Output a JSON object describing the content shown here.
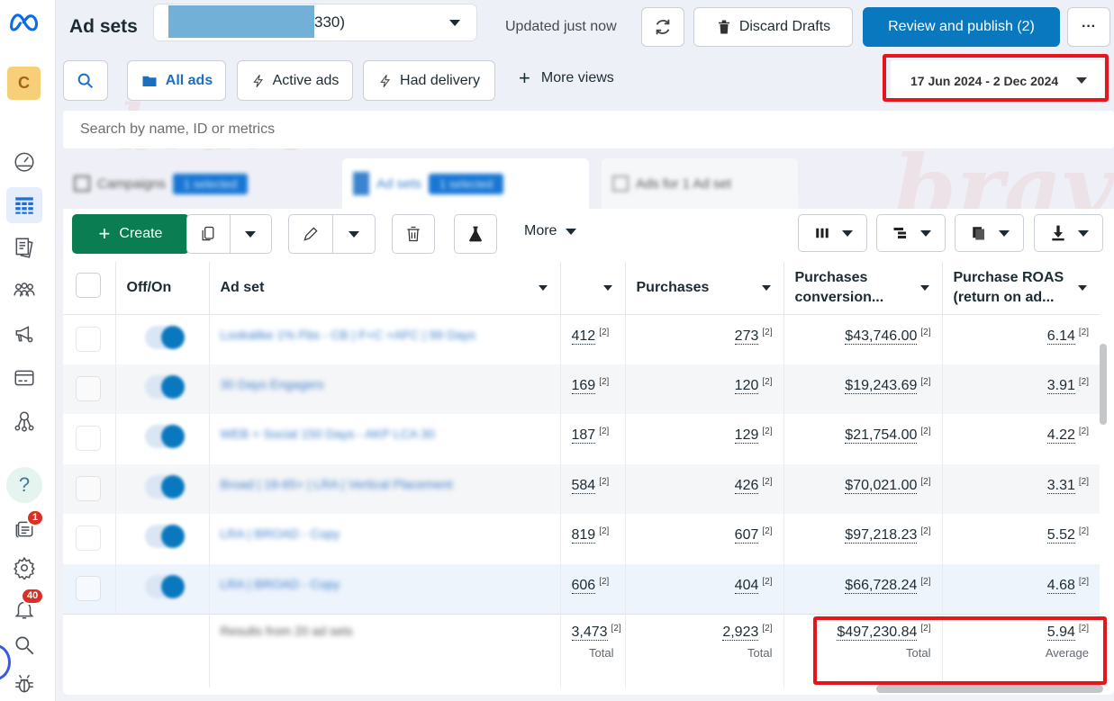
{
  "sidebar": {
    "logo": "meta-logo",
    "account_initial": "C",
    "items": [
      {
        "name": "account-overview",
        "icon": "gauge-icon"
      },
      {
        "name": "campaigns",
        "icon": "table-grid-icon",
        "active": true
      },
      {
        "name": "reports",
        "icon": "documents-icon"
      },
      {
        "name": "audiences",
        "icon": "people-icon"
      },
      {
        "name": "advertising-settings",
        "icon": "megaphone-icon"
      },
      {
        "name": "billing",
        "icon": "credit-card-icon"
      },
      {
        "name": "events-manager",
        "icon": "nodes-icon"
      },
      {
        "name": "help",
        "icon": "question-icon"
      },
      {
        "name": "news",
        "icon": "newspaper-icon",
        "badge": "1"
      },
      {
        "name": "settings",
        "icon": "gear-icon"
      },
      {
        "name": "notifications",
        "icon": "bell-icon",
        "badge": "40"
      },
      {
        "name": "search",
        "icon": "search-icon"
      },
      {
        "name": "report-bug",
        "icon": "bug-icon"
      }
    ]
  },
  "header": {
    "title": "Ad sets",
    "account_suffix": "330)",
    "updated": "Updated just now",
    "discard": "Discard Drafts",
    "publish": "Review and publish (2)",
    "more": "···"
  },
  "views": {
    "all_ads": "All ads",
    "active_ads": "Active ads",
    "had_delivery": "Had delivery",
    "more_views": "More views",
    "date_range": "17 Jun 2024 - 2 Dec 2024"
  },
  "search": {
    "placeholder": "Search by name, ID or metrics"
  },
  "tabs": [
    {
      "label": "Campaigns",
      "chip": "1 selected"
    },
    {
      "label": "Ad sets",
      "chip": "1 selected"
    },
    {
      "label": "Ads for 1 Ad set"
    }
  ],
  "actions": {
    "create": "Create",
    "more": "More"
  },
  "table": {
    "columns": [
      "Off/On",
      "Ad set",
      "",
      "Purchases",
      "Purchases conversion...",
      "Purchase ROAS (return on ad..."
    ],
    "rows": [
      {
        "name": "Lookalike 1% Fbs - CB | F+C +AFC | 99 Days",
        "c1": "412",
        "purchases": "273",
        "value": "$43,746.00",
        "roas": "6.14",
        "footnote": "[2]"
      },
      {
        "name": "30 Days Engagers",
        "c1": "169",
        "purchases": "120",
        "value": "$19,243.69",
        "roas": "3.91",
        "footnote": "[2]"
      },
      {
        "name": "WEB + Social 150 Days - AKP LCA 30",
        "c1": "187",
        "purchases": "129",
        "value": "$21,754.00",
        "roas": "4.22",
        "footnote": "[2]"
      },
      {
        "name": "Broad | 18-65+ | LRA | Vertical Placement",
        "c1": "584",
        "purchases": "426",
        "value": "$70,021.00",
        "roas": "3.31",
        "footnote": "[2]"
      },
      {
        "name": "LRA | BROAD - Copy",
        "c1": "819",
        "purchases": "607",
        "value": "$97,218.23",
        "roas": "5.52",
        "footnote": "[2]"
      },
      {
        "name": "LRA | BROAD - Copy",
        "c1": "606",
        "purchases": "404",
        "value": "$66,728.24",
        "roas": "4.68",
        "footnote": "[2]"
      }
    ],
    "footer": {
      "label": "Results from 20 ad sets",
      "c1": "3,473",
      "c1_sub": "Total",
      "purchases": "2,923",
      "purchases_sub": "Total",
      "value": "$497,230.84",
      "value_sub": "Total",
      "roas": "5.94",
      "roas_sub": "Average",
      "footnote": "[2]"
    }
  },
  "watermark": {
    "top": "creative",
    "bottom": "brave"
  }
}
